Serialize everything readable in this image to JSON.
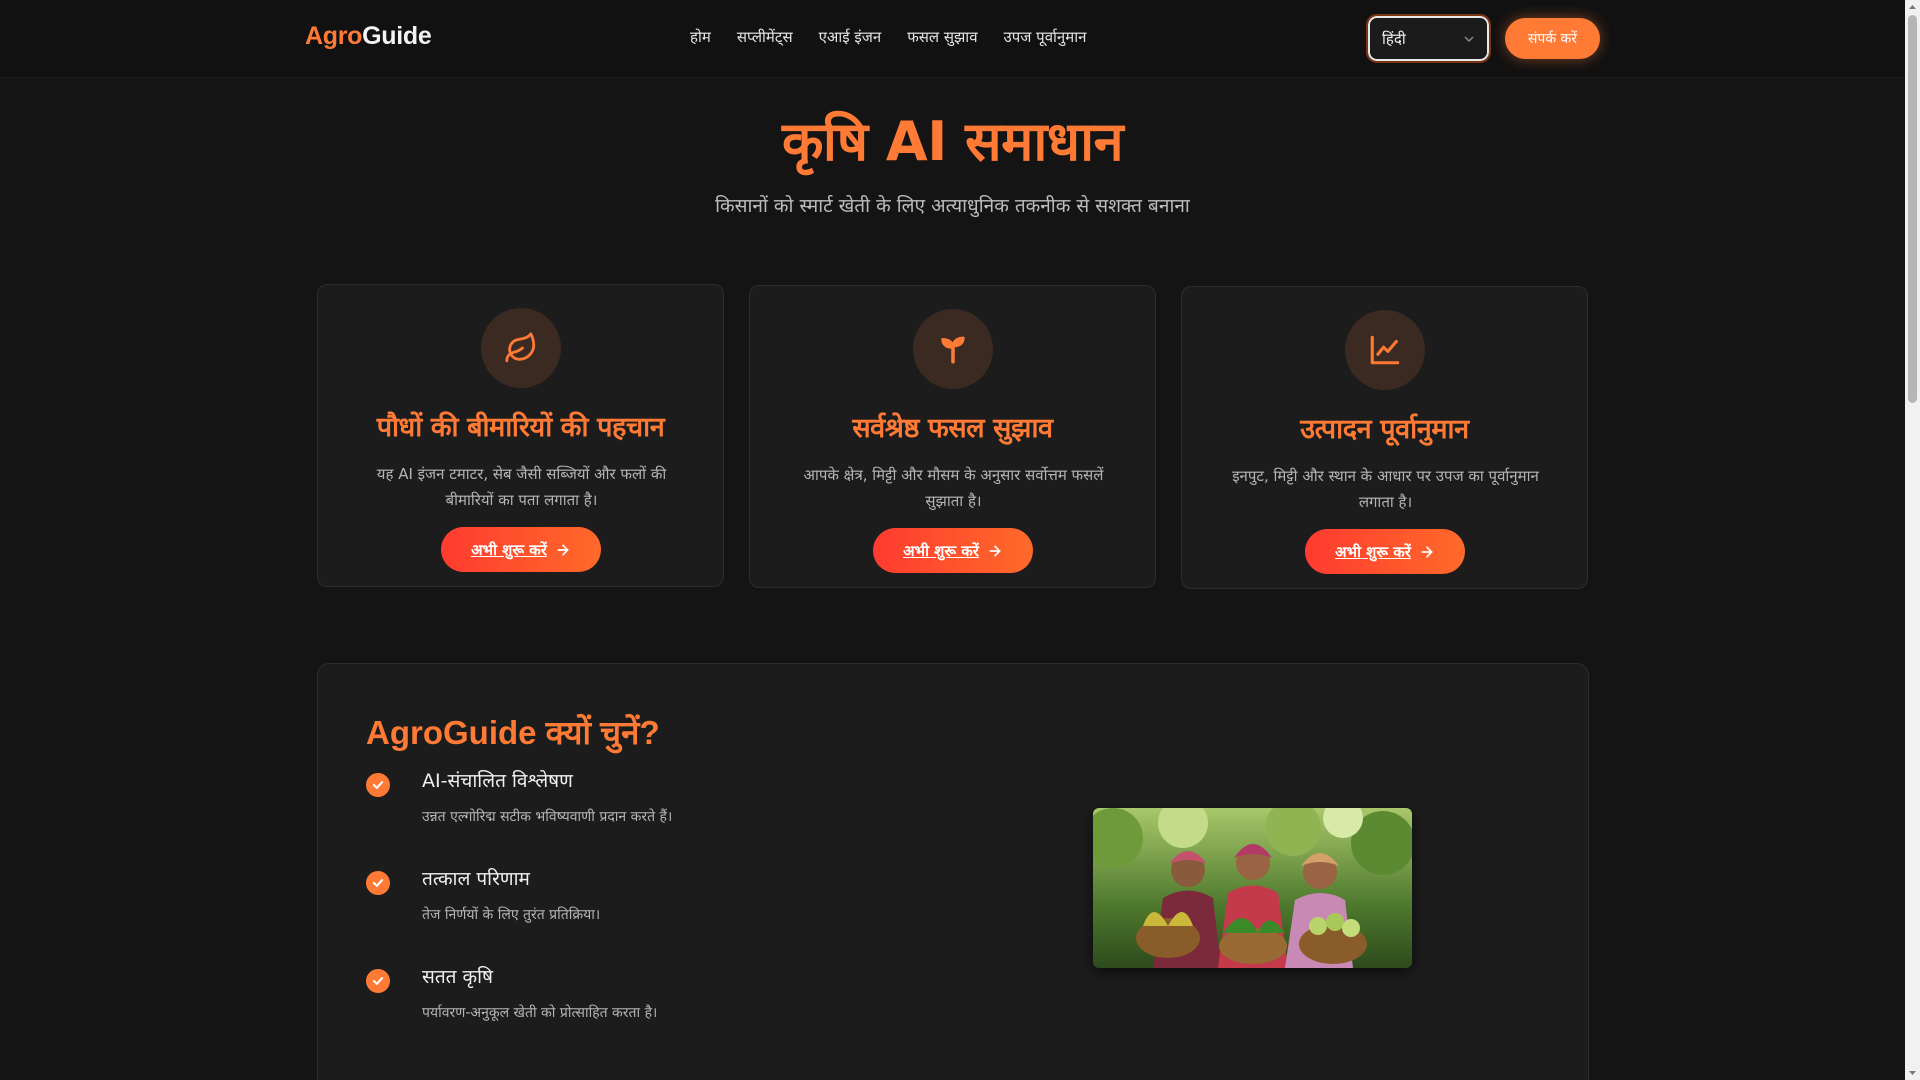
{
  "navbar": {
    "brand_part1": "Agro",
    "brand_part2": "Guide",
    "links": [
      "होम",
      "सप्लीमेंट्स",
      "एआई इंजन",
      "फसल सुझाव",
      "उपज पूर्वानुमान"
    ],
    "language_value": "हिंदी",
    "contact_label": "संपर्क करें"
  },
  "hero": {
    "title": "कृषि AI समाधान",
    "subtitle": "किसानों को स्मार्ट खेती के लिए अत्याधुनिक तकनीक से सशक्त बनाना"
  },
  "cards": [
    {
      "icon": "leaf-icon",
      "title": "पौधों की बीमारियों की पहचान",
      "description": "यह AI इंजन टमाटर, सेब जैसी सब्जियों और फलों की बीमारियों का पता लगाता है।",
      "button_label": "अभी शुरू करें"
    },
    {
      "icon": "sprout-icon",
      "title": "सर्वश्रेष्ठ फसल सुझाव",
      "description": "आपके क्षेत्र, मिट्टी और मौसम के अनुसार सर्वोत्तम फसलें सुझाता है।",
      "button_label": "अभी शुरू करें"
    },
    {
      "icon": "line-chart-icon",
      "title": "उत्पादन पूर्वानुमान",
      "description": "इनपुट, मिट्टी और स्थान के आधार पर उपज का पूर्वानुमान लगाता है।",
      "button_label": "अभी शुरू करें"
    }
  ],
  "why": {
    "title": "AgroGuide क्यों चुनें?",
    "features": [
      {
        "title": "AI-संचालित विश्लेषण",
        "description": "उन्नत एल्गोरिद्म सटीक भविष्यवाणी प्रदान करते हैं।"
      },
      {
        "title": "तत्काल परिणाम",
        "description": "तेज निर्णयों के लिए तुरंत प्रतिक्रिया।"
      },
      {
        "title": "सतत कृषि",
        "description": "पर्यावरण-अनुकूल खेती को प्रोत्साहित करता है।"
      }
    ]
  },
  "colors": {
    "accent": "#ff7a35",
    "background": "#141414",
    "card": "#1c1c1c",
    "button_gradient_start": "#ff3b2f",
    "button_gradient_end": "#ff6a2a"
  }
}
